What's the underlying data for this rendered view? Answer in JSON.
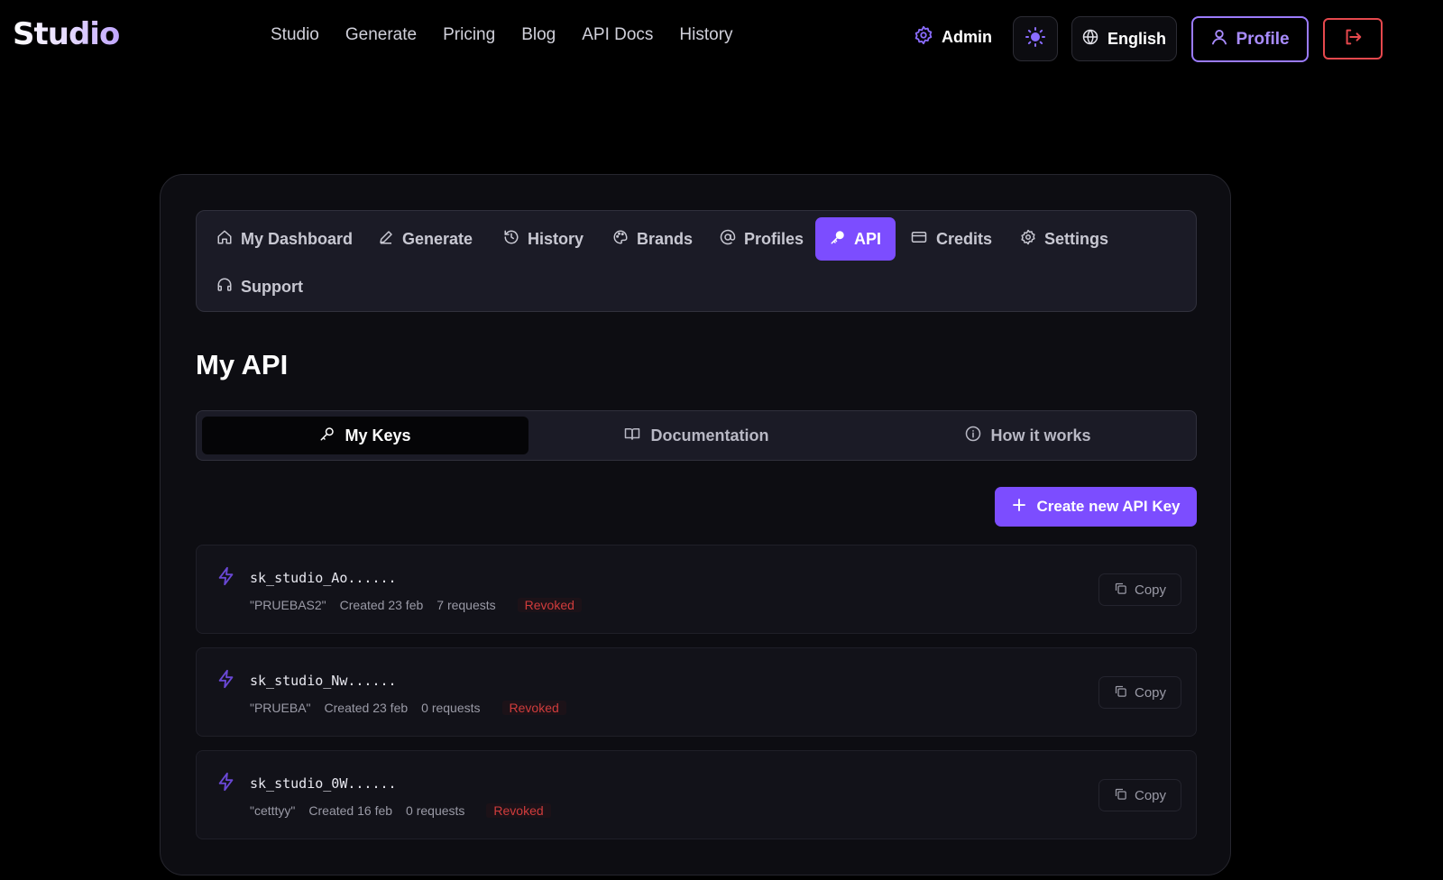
{
  "header": {
    "logo": "Studio",
    "nav": [
      "Studio",
      "Generate",
      "Pricing",
      "Blog",
      "API Docs",
      "History"
    ],
    "admin_label": "Admin",
    "language_label": "English",
    "profile_label": "Profile"
  },
  "subnav": {
    "items": [
      {
        "label": "My Dashboard",
        "icon": "home-icon"
      },
      {
        "label": "Generate",
        "icon": "pencil-icon"
      },
      {
        "label": "History",
        "icon": "history-icon"
      },
      {
        "label": "Brands",
        "icon": "palette-icon"
      },
      {
        "label": "Profiles",
        "icon": "at-sign-icon"
      },
      {
        "label": "API",
        "icon": "key-icon"
      },
      {
        "label": "Credits",
        "icon": "credit-card-icon"
      },
      {
        "label": "Settings",
        "icon": "gear-icon"
      },
      {
        "label": "Support",
        "icon": "headphones-icon"
      }
    ],
    "active": "API"
  },
  "page": {
    "title": "My API",
    "tabs": [
      {
        "label": "My Keys",
        "icon": "key-icon"
      },
      {
        "label": "Documentation",
        "icon": "book-icon"
      },
      {
        "label": "How it works",
        "icon": "info-icon"
      }
    ],
    "active_tab": "My Keys",
    "create_button_label": "Create new API Key"
  },
  "keys": [
    {
      "key": "sk_studio_Ao......",
      "name": "\"PRUEBAS2\"",
      "created": "Created 23 feb",
      "requests": "7 requests",
      "status": "Revoked",
      "copy_label": "Copy"
    },
    {
      "key": "sk_studio_Nw......",
      "name": "\"PRUEBA\"",
      "created": "Created 23 feb",
      "requests": "0 requests",
      "status": "Revoked",
      "copy_label": "Copy"
    },
    {
      "key": "sk_studio_0W......",
      "name": "\"cetttyy\"",
      "created": "Created 16 feb",
      "requests": "0 requests",
      "status": "Revoked",
      "copy_label": "Copy"
    }
  ],
  "colors": {
    "accent": "#7c4dff",
    "profile_border": "#9b7bff",
    "danger": "#e5484d",
    "background": "#000000",
    "panel": "#0d0d12"
  }
}
